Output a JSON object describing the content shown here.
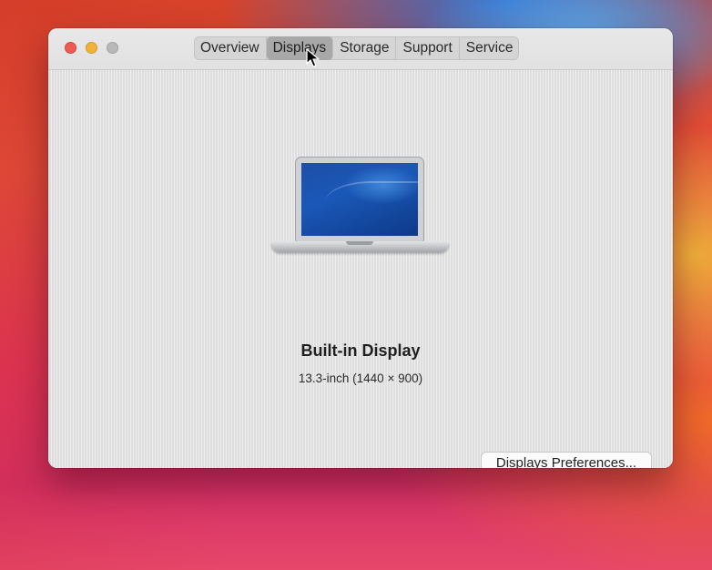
{
  "window": {
    "controls": {
      "close_icon": "close-icon",
      "minimize_icon": "minimize-icon",
      "zoom_icon": "zoom-icon",
      "close_color": "#ee5b52",
      "minimize_color": "#f1b23a",
      "zoom_color": "#b9b8b8"
    },
    "tabs": [
      {
        "label": "Overview",
        "active": false
      },
      {
        "label": "Displays",
        "active": true
      },
      {
        "label": "Storage",
        "active": false
      },
      {
        "label": "Support",
        "active": false
      },
      {
        "label": "Service",
        "active": false
      }
    ]
  },
  "displays": {
    "image_icon": "macbook-air-icon",
    "name": "Built-in Display",
    "spec": "13.3-inch (1440 × 900)",
    "preferences_button": "Displays Preferences..."
  },
  "cursor_icon": "arrow-pointer-icon"
}
